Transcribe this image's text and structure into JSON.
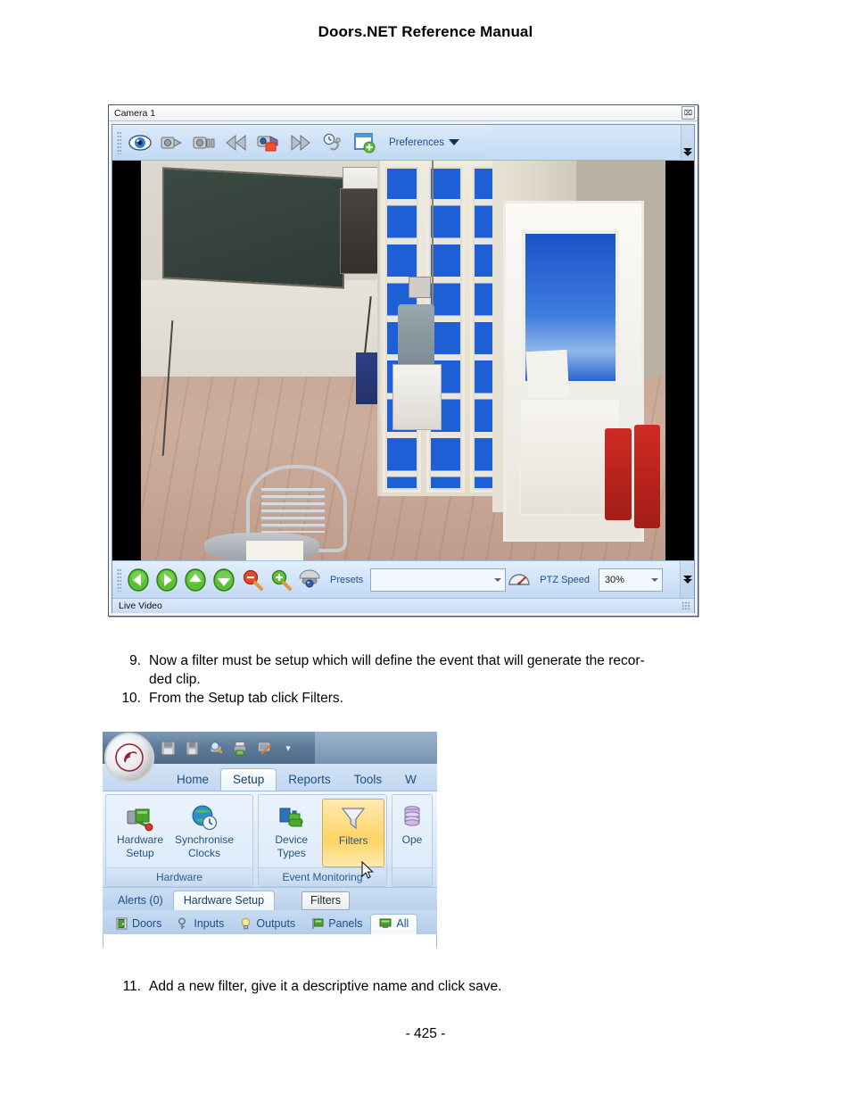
{
  "document": {
    "header_title": "Doors.NET Reference Manual",
    "page_footer": "- 425 -"
  },
  "camera_window": {
    "title": "Camera 1",
    "close_glyph": "⌧",
    "status_text": "Live Video",
    "toolbar": {
      "buttons": [
        {
          "name": "live-view",
          "icon": "eye-icon"
        },
        {
          "name": "camera-play",
          "icon": "camcorder-play-icon"
        },
        {
          "name": "camera-pause",
          "icon": "camcorder-pause-icon"
        },
        {
          "name": "rewind",
          "icon": "rewind-icon"
        },
        {
          "name": "record",
          "icon": "camcorder-record-icon"
        },
        {
          "name": "fast-forward",
          "icon": "fast-forward-icon"
        },
        {
          "name": "schedule",
          "icon": "clock-timer-icon"
        },
        {
          "name": "new-window",
          "icon": "add-window-icon"
        }
      ],
      "preferences_label": "Preferences"
    },
    "ptz": {
      "nav_buttons": [
        {
          "name": "pan-left",
          "icon": "arrow-left-icon"
        },
        {
          "name": "pan-right",
          "icon": "arrow-right-icon"
        },
        {
          "name": "tilt-up",
          "icon": "arrow-up-icon"
        },
        {
          "name": "tilt-down",
          "icon": "arrow-down-icon"
        },
        {
          "name": "zoom-out",
          "icon": "zoom-out-icon"
        },
        {
          "name": "zoom-in",
          "icon": "zoom-in-icon"
        },
        {
          "name": "dome-camera",
          "icon": "dome-camera-icon"
        }
      ],
      "presets_label": "Presets",
      "presets_value": "",
      "speed_label": "PTZ Speed",
      "speed_value": "30%"
    }
  },
  "steps": [
    {
      "num": "9.",
      "text": "Now a filter must be setup which will define the event that will generate the recor-"
    },
    {
      "num": "",
      "text": "ded clip."
    },
    {
      "num": "10.",
      "text": "From the Setup tab click Filters."
    }
  ],
  "step11": {
    "num": "11.",
    "text": "Add a new filter, give it a descriptive name and click save."
  },
  "ribbon": {
    "quick_access": [
      {
        "name": "save-icon"
      },
      {
        "name": "save-as-icon"
      },
      {
        "name": "print-preview-icon"
      },
      {
        "name": "print-icon"
      },
      {
        "name": "screen-icon"
      }
    ],
    "qat_dropdown_glyph": "▾",
    "tabs": [
      {
        "label": "Home",
        "active": false
      },
      {
        "label": "Setup",
        "active": true
      },
      {
        "label": "Reports",
        "active": false
      },
      {
        "label": "Tools",
        "active": false
      },
      {
        "label": "W",
        "active": false
      }
    ],
    "groups": [
      {
        "title": "Hardware",
        "items": [
          {
            "label_line1": "Hardware",
            "label_line2": "Setup",
            "icon": "hardware-setup-icon",
            "highlighted": false
          },
          {
            "label_line1": "Synchronise",
            "label_line2": "Clocks",
            "icon": "synchronise-clocks-icon",
            "highlighted": false
          }
        ]
      },
      {
        "title": "Event Monitoring",
        "items": [
          {
            "label_line1": "Device",
            "label_line2": "Types",
            "icon": "device-types-icon",
            "highlighted": false
          },
          {
            "label_line1": "Filters",
            "label_line2": "",
            "icon": "funnel-filter-icon",
            "highlighted": true
          }
        ]
      },
      {
        "title": "",
        "items": [
          {
            "label_line1": "Ope",
            "label_line2": "",
            "icon": "database-icon",
            "highlighted": false
          }
        ]
      }
    ],
    "lower_tabs": [
      {
        "label": "Alerts (0)",
        "active": false,
        "boxed": false
      },
      {
        "label": "Hardware Setup",
        "active": true,
        "boxed": false
      },
      {
        "label": "Filters",
        "active": false,
        "boxed": true
      }
    ],
    "sub_tabs": [
      {
        "label": "Doors",
        "icon": "door-icon",
        "active": false
      },
      {
        "label": "Inputs",
        "icon": "input-key-icon",
        "active": false
      },
      {
        "label": "Outputs",
        "icon": "lightbulb-icon",
        "active": false
      },
      {
        "label": "Panels",
        "icon": "panel-icon",
        "active": false
      },
      {
        "label": "All",
        "icon": "all-devices-icon",
        "active": true
      }
    ],
    "cursor_icon": "mouse-pointer-icon"
  },
  "colors": {
    "accent_blue": "#1c4f86",
    "highlight_gold": "#ffd463",
    "chrome_blue": "#cfe2f7"
  }
}
